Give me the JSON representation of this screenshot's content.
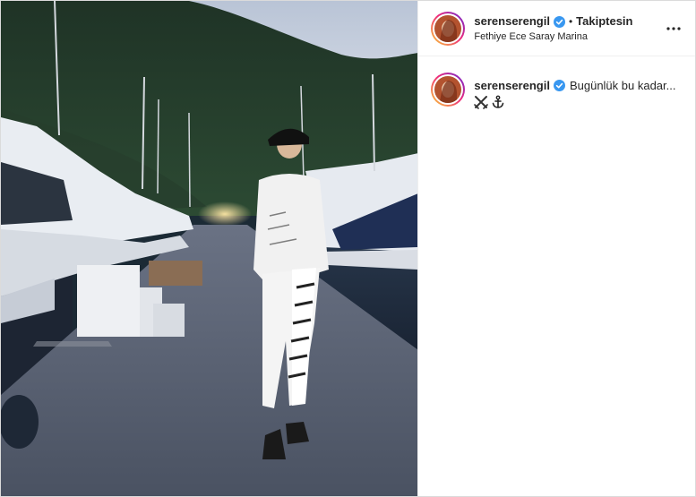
{
  "post": {
    "author": {
      "username": "serenserengil",
      "verified": true,
      "follow_state": "Takiptesin",
      "location": "Fethiye Ece Saray Marina"
    },
    "caption": {
      "username": "serenserengil",
      "text": "Bugünlük bu kadar...",
      "emojis": [
        "crossed-swords-icon",
        "anchor-icon"
      ]
    },
    "header": {
      "separator": "•"
    },
    "colors": {
      "verified_badge": "#3897f0",
      "text": "#262626",
      "border": "#dbdbdb"
    },
    "icons": {
      "more": "more-options-icon",
      "verified": "verified-badge-icon"
    }
  }
}
